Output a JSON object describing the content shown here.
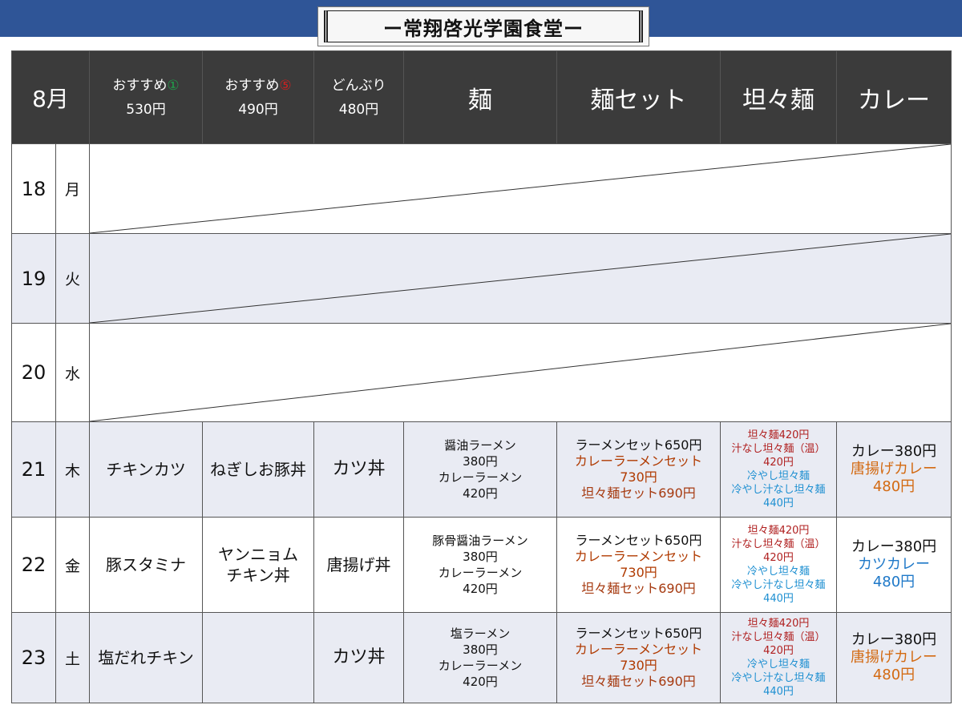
{
  "header": {
    "title": "ー常翔啓光学園食堂ー"
  },
  "colors": {
    "topbar": "#2f5597",
    "table_header_bg": "#3b3b3b",
    "row_shade": "#e9ebf3"
  },
  "table": {
    "month": "8月",
    "columns": [
      {
        "name": "おすすめ",
        "mark": "①",
        "price": "530円"
      },
      {
        "name": "おすすめ",
        "mark": "⑤",
        "price": "490円"
      },
      {
        "name": "どんぶり",
        "mark": "",
        "price": "480円"
      },
      {
        "name": "麺"
      },
      {
        "name": "麺セット"
      },
      {
        "name": "坦々麺"
      },
      {
        "name": "カレー"
      }
    ],
    "rows": [
      {
        "day": "18",
        "weekday": "月"
      },
      {
        "day": "19",
        "weekday": "火"
      },
      {
        "day": "20",
        "weekday": "水"
      },
      {
        "day": "21",
        "weekday": "木",
        "rec1": "チキンカツ",
        "rec5": "ねぎしお豚丼",
        "donburi": "カツ丼",
        "noodle": [
          "醤油ラーメン",
          "380円",
          "カレーラーメン",
          "420円"
        ],
        "set": [
          "ラーメンセット650円",
          "カレーラーメンセット",
          "730円",
          "坦々麺セット690円"
        ],
        "dandan": [
          "坦々麺420円",
          "汁なし坦々麺（温）",
          "420円",
          "冷やし坦々麺",
          "冷やし汁なし坦々麺",
          "440円"
        ],
        "curry": [
          "カレー380円",
          "唐揚げカレー",
          "480円"
        ]
      },
      {
        "day": "22",
        "weekday": "金",
        "rec1": "豚スタミナ",
        "rec5": [
          "ヤンニョム",
          "チキン丼"
        ],
        "donburi": "唐揚げ丼",
        "noodle": [
          "豚骨醤油ラーメン",
          "380円",
          "カレーラーメン",
          "420円"
        ],
        "set": [
          "ラーメンセット650円",
          "カレーラーメンセット",
          "730円",
          "坦々麺セット690円"
        ],
        "dandan": [
          "坦々麺420円",
          "汁なし坦々麺（温）",
          "420円",
          "冷やし坦々麺",
          "冷やし汁なし坦々麺",
          "440円"
        ],
        "curry": [
          "カレー380円",
          "カツカレー",
          "480円"
        ]
      },
      {
        "day": "23",
        "weekday": "土",
        "rec1": "塩だれチキン",
        "rec5": "",
        "donburi": "カツ丼",
        "noodle": [
          "塩ラーメン",
          "380円",
          "カレーラーメン",
          "420円"
        ],
        "set": [
          "ラーメンセット650円",
          "カレーラーメンセット",
          "730円",
          "坦々麺セット690円"
        ],
        "dandan": [
          "坦々麺420円",
          "汁なし坦々麺（温）",
          "420円",
          "冷やし坦々麺",
          "冷やし汁なし坦々麺",
          "440円"
        ],
        "curry": [
          "カレー380円",
          "唐揚げカレー",
          "480円"
        ]
      }
    ]
  }
}
